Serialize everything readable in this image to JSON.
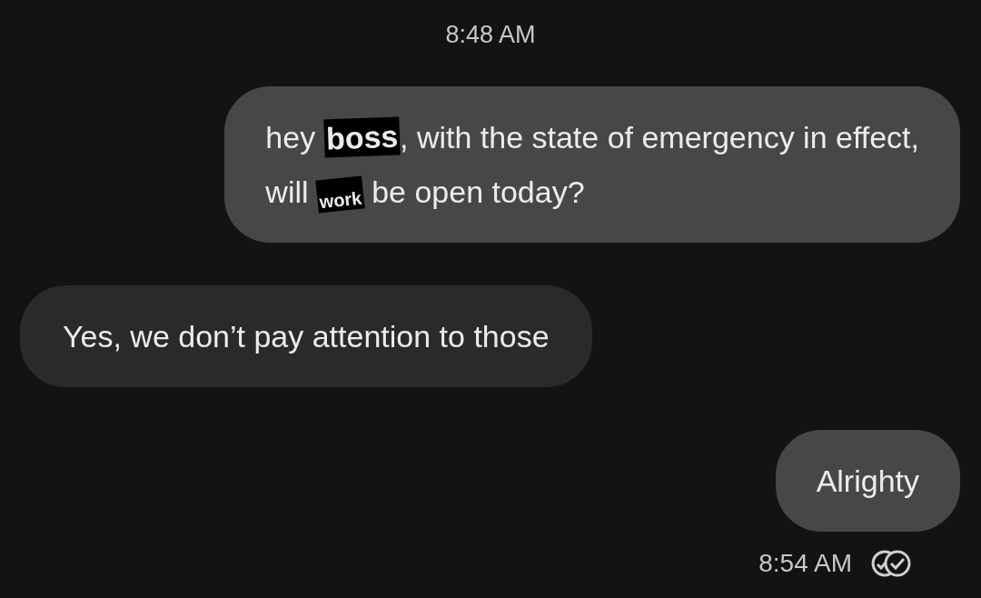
{
  "timestamp": "8:48 AM",
  "messages": [
    {
      "kind": "outgoing",
      "lines": [
        [
          {
            "kind": "text",
            "text": "hey "
          },
          {
            "kind": "redaction",
            "text": "boss"
          },
          {
            "kind": "text",
            "text": ", with the state of emergency in effect,"
          }
        ],
        [
          {
            "kind": "text",
            "text": "will "
          },
          {
            "kind": "sticker",
            "text": "work"
          },
          {
            "kind": "text",
            "text": " be open today?"
          }
        ]
      ]
    },
    {
      "kind": "incoming",
      "lines": [
        [
          {
            "kind": "text",
            "text": "Yes, we don’t pay attention to those"
          }
        ]
      ]
    },
    {
      "kind": "outgoing",
      "lines": [
        [
          {
            "kind": "text",
            "text": "Alrighty"
          }
        ]
      ]
    }
  ],
  "footer": {
    "time": "8:54 AM",
    "read": true
  }
}
